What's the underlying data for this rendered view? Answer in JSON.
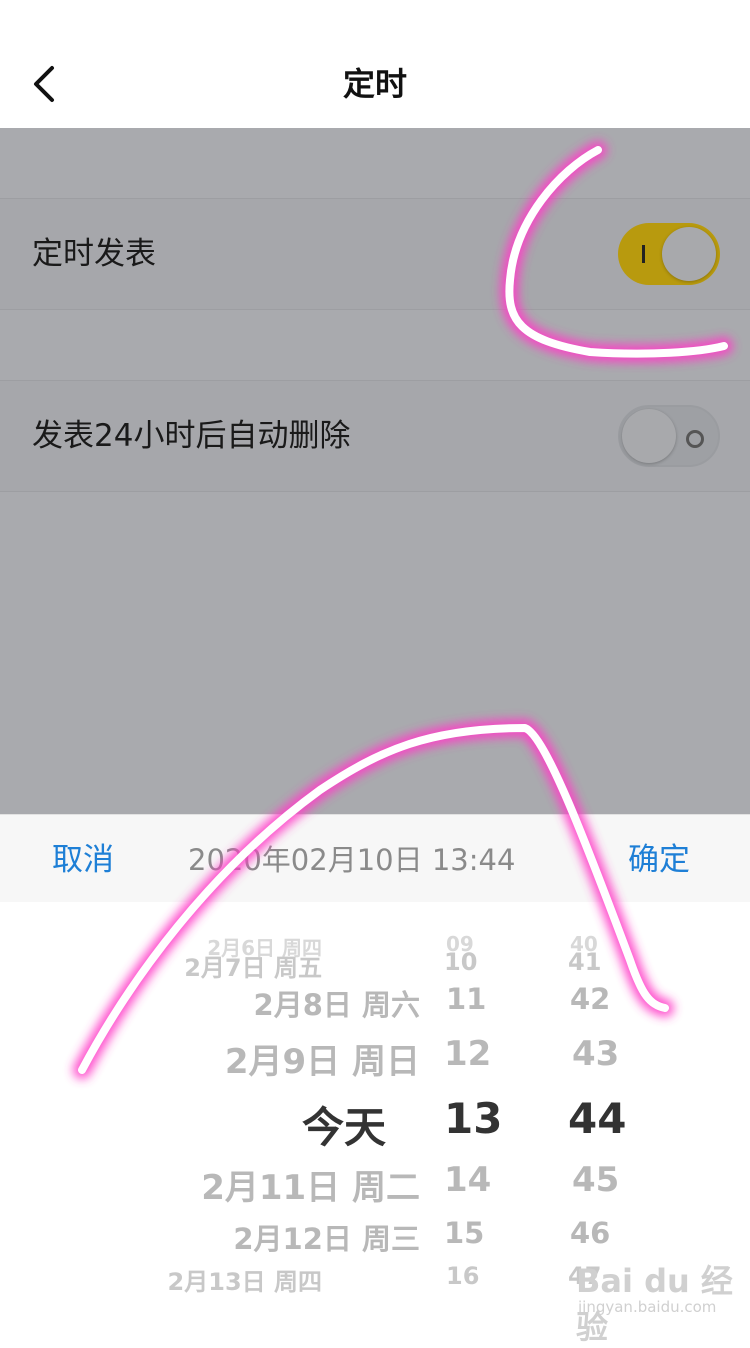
{
  "header": {
    "title": "定时"
  },
  "settings": [
    {
      "label": "定时发表",
      "enabled": true
    },
    {
      "label": "发表24小时后自动删除",
      "enabled": false
    }
  ],
  "toolbar": {
    "cancel": "取消",
    "value": "2020年02月10日 13:44",
    "confirm": "确定"
  },
  "picker": {
    "dates": [
      "2月6日 周四",
      "2月7日 周五",
      "2月8日 周六",
      "2月9日 周日",
      "今天",
      "2月11日 周二",
      "2月12日 周三",
      "2月13日 周四"
    ],
    "hours": [
      "09",
      "10",
      "11",
      "12",
      "13",
      "14",
      "15",
      "16"
    ],
    "minutes": [
      "40",
      "41",
      "42",
      "43",
      "44",
      "45",
      "46",
      "47"
    ]
  },
  "watermark": {
    "logo": "Bai du 经验",
    "url": "jingyan.baidu.com"
  },
  "colors": {
    "accent": "#1e7fd6",
    "switch_on": "#b89a0e",
    "annotation": "#ff3cc8"
  }
}
